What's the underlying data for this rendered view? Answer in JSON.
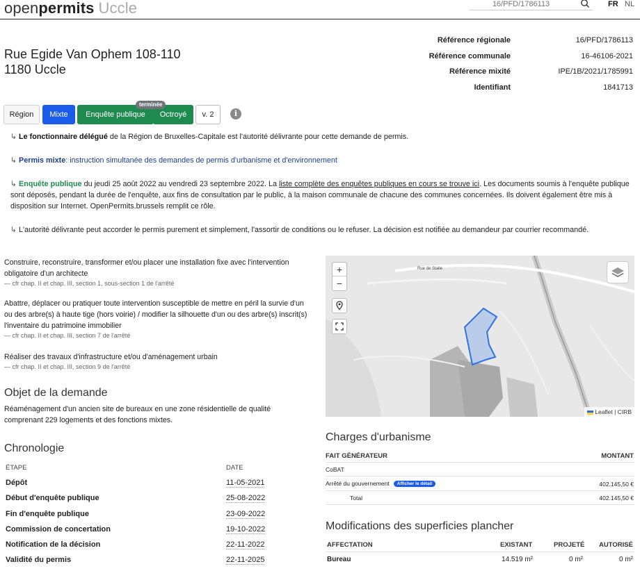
{
  "header": {
    "brand_open": "open",
    "brand_permits": "permits",
    "brand_city": "Uccle",
    "search_placeholder": "16/PFD/1786113",
    "lang_fr": "FR",
    "lang_nl": "NL"
  },
  "address": {
    "street": "Rue Egide Van Ophem 108-110",
    "city": "1180 Uccle"
  },
  "references": [
    {
      "label": "Référence régionale",
      "value": "16/PFD/1786113"
    },
    {
      "label": "Référence communale",
      "value": "16-46106-2021"
    },
    {
      "label": "Référence mixité",
      "value": "IPE/1B/2021/1785991"
    },
    {
      "label": "Identifiant",
      "value": "1841713"
    }
  ],
  "badges": {
    "region": "Région",
    "mixte": "Mixte",
    "enquete": "Enquête publique",
    "termine": "terminée",
    "octroye": "Octroyé",
    "version": "v. 2",
    "info": "i"
  },
  "notices": {
    "n1_bold": "Le fonctionnaire délégué",
    "n1_rest": " de la Région de Bruxelles-Capitale est l'autorité délivrante pour cette demande de permis.",
    "n2_bold": "Permis mixte",
    "n2_rest": ": instruction simultanée des demandes de permis d'urbanisme et d'environnement",
    "n3_bold": "Enquête publique",
    "n3_dates": " du jeudi 25 août 2022 au vendredi 23 septembre 2022. La ",
    "n3_link": "liste complète des enquêtes publiques en cours se trouve ici",
    "n3_rest": ". Les documents soumis à l'enquête publique sont déposés, pendant la durée de l'enquête, aux fins de consultation par le public, à la maison communale de chacune des communes concernées. Ils doivent également être mis à disposition sur Internet. OpenPermits.brussels remplit ce rôle.",
    "n4": "L'autorité délivrante peut accorder le permis purement et simplement, l'assortir de conditions ou le refuser. La décision est notifiée au demandeur par courrier recommandé."
  },
  "items": [
    {
      "text": "Construire, reconstruire, transformer et/ou placer une installation fixe avec l'intervention obligatoire d'un architecte",
      "cite": "— cfr chap. II et chap. III, section 1, sous-section 1 de l'arrêté"
    },
    {
      "text": "Abattre, déplacer ou pratiquer toute intervention susceptible de mettre en péril la survie d'un ou des arbre(s) à haute tige (hors voirie) / modifier la silhouette d'un ou des arbre(s) inscrit(s) l'inventaire du patrimoine immobilier",
      "cite": "— cfr chap. II et chap. III, section 7 de l'arrêté"
    },
    {
      "text": "Réaliser des travaux d'infrastructure et/ou d'aménagement urbain",
      "cite": "— cfr chap. II et chap. III, section 9 de l'arrêté"
    }
  ],
  "objet": {
    "title": "Objet de la demande",
    "text": "Réaménagement d'un ancien site de bureaux en une zone résidentielle de qualité comprenant 229 logements et des fonctions mixtes."
  },
  "chrono": {
    "title": "Chronologie",
    "col_step": "ÉTAPE",
    "col_date": "DATE",
    "rows": [
      {
        "label": "Dépôt",
        "date": "11-05-2021"
      },
      {
        "label": "Début d'enquête publique",
        "date": "25-08-2022"
      },
      {
        "label": "Fin d'enquête publique",
        "date": "23-09-2022"
      },
      {
        "label": "Commission de concertation",
        "date": "19-10-2022"
      },
      {
        "label": "Notification de la décision",
        "date": "22-11-2022"
      },
      {
        "label": "Validité du permis",
        "date": "22-11-2025"
      }
    ]
  },
  "map": {
    "street_label": "Rue de Stalle",
    "zoom_in": "+",
    "zoom_out": "−",
    "attribution": "Leaflet | CIRB"
  },
  "charges": {
    "title": "Charges d'urbanisme",
    "col_fait": "FAIT GÉNÉRATEUR",
    "col_montant": "MONTANT",
    "cobat": "CoBAT",
    "arrete": "Arrêté du gouvernement",
    "detail_btn": "Afficher le détail",
    "arrete_amount": "402.145,50 €",
    "total_label": "Total",
    "total_amount": "402.145,50 €"
  },
  "superficies": {
    "title": "Modifications des superficies plancher",
    "col_affectation": "AFFECTATION",
    "col_existant": "EXISTANT",
    "col_projete": "PROJETÉ",
    "col_autorise": "AUTORISÉ",
    "row_label": "Bureau",
    "row_existant": "14.519 m²",
    "row_projete": "0 m²",
    "row_autorise": "0 m²"
  }
}
